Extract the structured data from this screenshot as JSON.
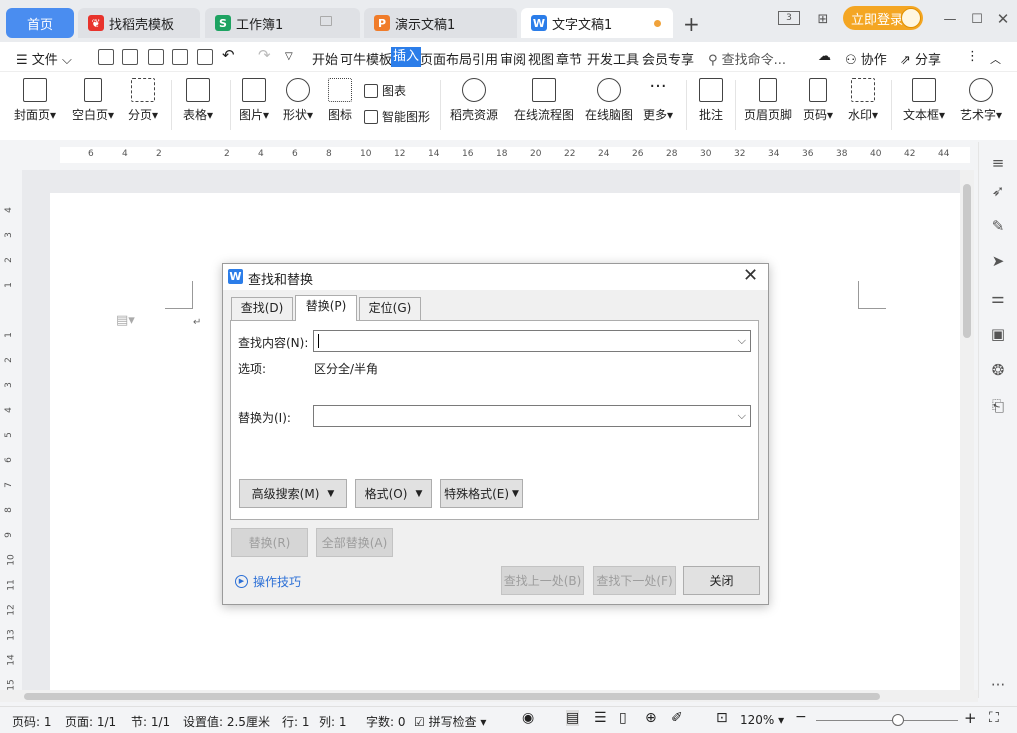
{
  "tabs": {
    "home": "首页",
    "daoke": "找稻壳模板",
    "sheet": "工作簿1",
    "ppt": "演示文稿1",
    "doc": "文字文稿1"
  },
  "login_label": "立即登录",
  "menu": {
    "file": "文件",
    "items": [
      "开始",
      "可牛模板",
      "插入",
      "页面布局",
      "引用",
      "审阅",
      "视图",
      "章节",
      "开发工具",
      "会员专享"
    ],
    "search_placeholder": "查找命令...",
    "collab": "协作",
    "share": "分享"
  },
  "ribbon": {
    "cover": "封面页",
    "blank": "空白页",
    "pagebreak": "分页",
    "table": "表格",
    "picture": "图片",
    "shape": "形状",
    "icon": "图标",
    "chart": "图表",
    "smartart": "智能图形",
    "daoke_res": "稻壳资源",
    "flowchart": "在线流程图",
    "mindmap": "在线脑图",
    "more": "更多",
    "comment": "批注",
    "headerfooter": "页眉页脚",
    "pagenum": "页码",
    "watermark": "水印",
    "textbox": "文本框",
    "wordart": "艺术字"
  },
  "ruler": {
    "h": [
      "6",
      "4",
      "2",
      "2",
      "4",
      "6",
      "8",
      "10",
      "12",
      "14",
      "16",
      "18",
      "20",
      "22",
      "24",
      "26",
      "28",
      "30",
      "32",
      "34",
      "36",
      "38",
      "40",
      "42",
      "44"
    ],
    "v": [
      "4",
      "3",
      "2",
      "1",
      "1",
      "2",
      "3",
      "4",
      "5",
      "6",
      "7",
      "8",
      "9",
      "10",
      "11",
      "12",
      "13",
      "14",
      "15"
    ]
  },
  "dialog": {
    "title": "查找和替换",
    "tab_find": "查找(D)",
    "tab_replace": "替换(P)",
    "tab_goto": "定位(G)",
    "find_label": "查找内容(N):",
    "find_value": "",
    "options_label": "选项:",
    "options_value": "区分全/半角",
    "replace_label": "替换为(I):",
    "replace_value": "",
    "advanced": "高级搜索(M)",
    "format": "格式(O)",
    "special": "特殊格式(E)",
    "replace_btn": "替换(R)",
    "replace_all": "全部替换(A)",
    "tips": "操作技巧",
    "find_prev": "查找上一处(B)",
    "find_next": "查找下一处(F)",
    "close": "关闭"
  },
  "status": {
    "page": "页码: 1",
    "pages": "页面: 1/1",
    "section": "节: 1/1",
    "setting": "设置值: 2.5厘米",
    "row": "行: 1",
    "col": "列: 1",
    "words": "字数: 0",
    "spell": "拼写检查",
    "zoom": "120%",
    "zoom_level": 0.58
  }
}
